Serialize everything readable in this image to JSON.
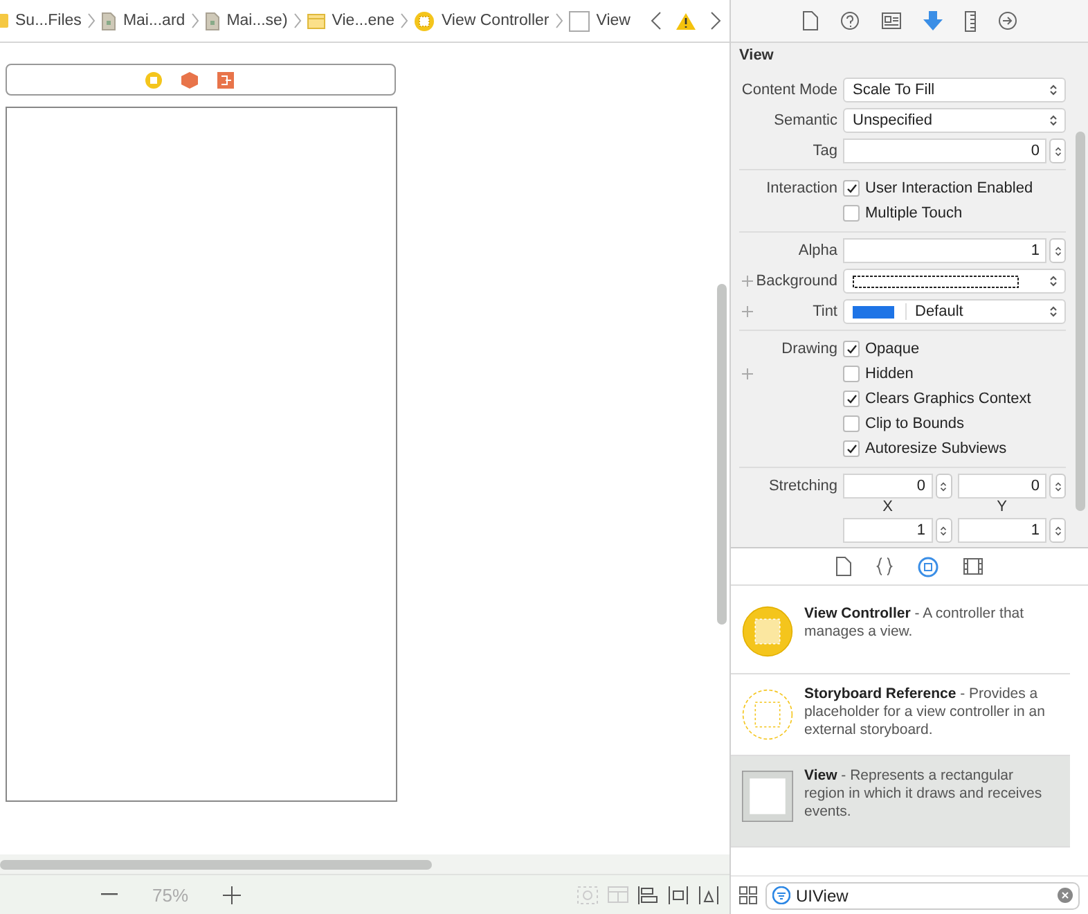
{
  "breadcrumbs": [
    {
      "kind": "folder",
      "label": "Su...Files"
    },
    {
      "kind": "storyboard",
      "label": "Mai...ard"
    },
    {
      "kind": "storyboard",
      "label": "Mai...se)"
    },
    {
      "kind": "scene",
      "label": "Vie...ene"
    },
    {
      "kind": "controller",
      "label": "View Controller"
    },
    {
      "kind": "view",
      "label": "View"
    }
  ],
  "inspector_tabs": [
    {
      "kind": "file",
      "selected": false
    },
    {
      "kind": "help",
      "selected": false
    },
    {
      "kind": "identity",
      "selected": false
    },
    {
      "kind": "attributes",
      "selected": true
    },
    {
      "kind": "size",
      "selected": false
    },
    {
      "kind": "connections",
      "selected": false
    }
  ],
  "inspector": {
    "title": "View",
    "groups": [
      {
        "rows": [
          {
            "kind": "popup",
            "label": "Content Mode",
            "value": "Scale To Fill"
          },
          {
            "kind": "popup",
            "label": "Semantic",
            "value": "Unspecified"
          },
          {
            "kind": "stepper",
            "label": "Tag",
            "value": "0"
          }
        ]
      },
      {
        "rows": [
          {
            "kind": "checks",
            "label": "Interaction",
            "items": [
              {
                "label": "User Interaction Enabled",
                "checked": true
              },
              {
                "label": "Multiple Touch",
                "checked": false
              }
            ]
          }
        ]
      },
      {
        "rows": [
          {
            "kind": "stepper",
            "label": "Alpha",
            "value": "1"
          },
          {
            "kind": "color",
            "label": "Background",
            "plus": true,
            "clear": true
          },
          {
            "kind": "color",
            "label": "Tint",
            "plus": true,
            "color": "#1e74e6",
            "value": "Default"
          }
        ]
      },
      {
        "rows": [
          {
            "kind": "checks",
            "label": "Drawing",
            "items": [
              {
                "label": "Opaque",
                "checked": true
              },
              {
                "label": "Hidden",
                "checked": false,
                "plus": true
              },
              {
                "label": "Clears Graphics Context",
                "checked": true
              },
              {
                "label": "Clip to Bounds",
                "checked": false
              },
              {
                "label": "Autoresize Subviews",
                "checked": true
              }
            ]
          }
        ]
      },
      {
        "rows": [
          {
            "kind": "pairs",
            "label": "Stretching",
            "fields": [
              {
                "value": "0",
                "caption": "X"
              },
              {
                "value": "0",
                "caption": "Y"
              },
              {
                "value": "1"
              },
              {
                "value": "1"
              }
            ]
          }
        ]
      }
    ]
  },
  "library_tabs": [
    {
      "kind": "file",
      "selected": false
    },
    {
      "kind": "code",
      "selected": false
    },
    {
      "kind": "object",
      "selected": true
    },
    {
      "kind": "media",
      "selected": false
    }
  ],
  "library": [
    {
      "kind": "controller",
      "title": "View Controller",
      "description": "- A controller that manages a view.",
      "selected": false
    },
    {
      "kind": "reference",
      "title": "Storyboard Reference",
      "description": "- Provides a placeholder for a view controller in an external storyboard.",
      "selected": false
    },
    {
      "kind": "view",
      "title": "View",
      "description": "- Represents a rectangular region in which it draws and receives events.",
      "selected": true
    }
  ],
  "filter": {
    "value": "UIView"
  },
  "zoom": "75%"
}
